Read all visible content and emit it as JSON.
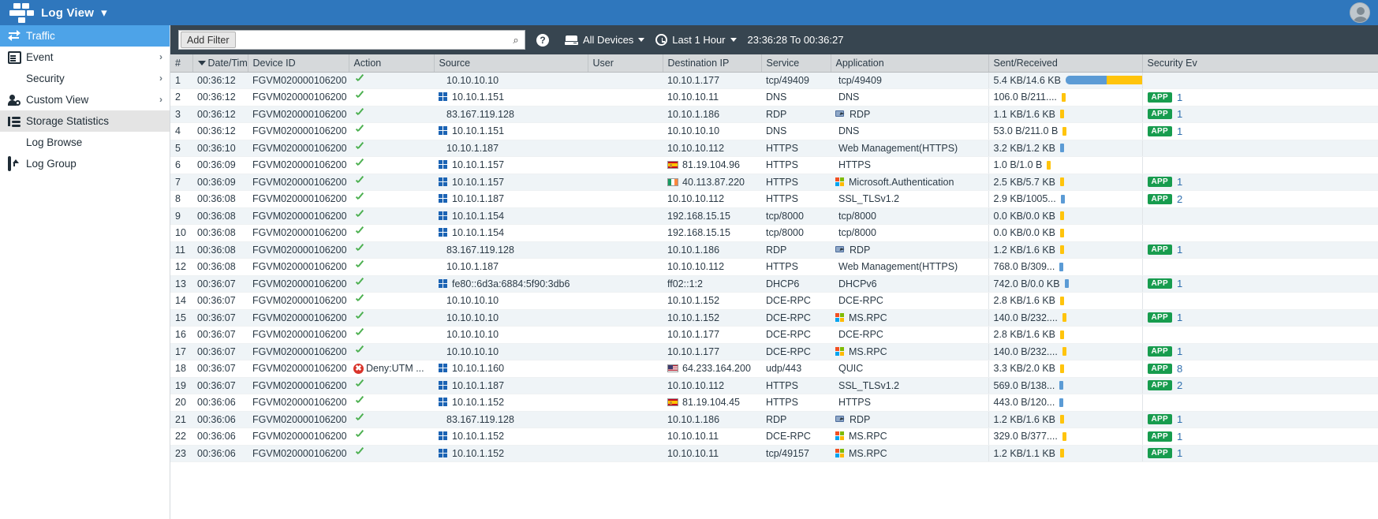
{
  "app": {
    "title": "Log View",
    "logo_icon": "grid-logo-icon",
    "title_chevron_icon": "chevron-down-icon",
    "avatar_icon": "user-avatar-icon",
    "brand_color": "#2f77bd"
  },
  "sidebar": {
    "items": [
      {
        "label": "Traffic",
        "icon": "traffic-icon",
        "state": "active",
        "chevron": ""
      },
      {
        "label": "Event",
        "icon": "event-icon",
        "state": "normal",
        "chevron": "›"
      },
      {
        "label": "Security",
        "icon": "shield-icon",
        "state": "normal",
        "chevron": "›"
      },
      {
        "label": "Custom View",
        "icon": "custom-view-icon",
        "state": "normal",
        "chevron": "›"
      },
      {
        "label": "Storage Statistics",
        "icon": "storage-icon",
        "state": "hover",
        "chevron": ""
      },
      {
        "label": "Log Browse",
        "icon": "log-browse-icon",
        "state": "normal",
        "chevron": ""
      },
      {
        "label": "Log Group",
        "icon": "log-group-icon",
        "state": "normal",
        "chevron": ""
      }
    ]
  },
  "toolbar": {
    "add_filter_label": "Add Filter",
    "filter_value": "",
    "filter_placeholder": "",
    "search_icon": "search-icon",
    "help_icon": "help-icon",
    "help_label": "?",
    "devices_icon": "device-icon",
    "devices_label": "All Devices",
    "time_icon": "clock-icon",
    "time_label": "Last 1 Hour",
    "time_range": "23:36:28 To 00:36:27"
  },
  "table": {
    "columns": [
      "#",
      "Date/Time",
      "Device ID",
      "Action",
      "Source",
      "User",
      "Destination IP",
      "Service",
      "Application",
      "Sent/Received",
      "Security Ev"
    ],
    "sorted_column": "Date/Time",
    "sort_direction": "desc",
    "rows": [
      {
        "num": "1",
        "time": "00:36:12",
        "device": "FGVM020000106200",
        "action": "allow",
        "action_text": "",
        "src_icon": "",
        "src": "10.10.10.10",
        "user": "",
        "dst_icon": "",
        "dst": "10.10.1.177",
        "service": "tcp/49409",
        "app_icon": "",
        "app": "tcp/49409",
        "sent": "5.4 KB/14.6 KB",
        "bar": "dual-wide",
        "sec_badge": "",
        "sec_count": ""
      },
      {
        "num": "2",
        "time": "00:36:12",
        "device": "FGVM020000106200",
        "action": "allow",
        "action_text": "",
        "src_icon": "windows",
        "src": "10.10.1.151",
        "user": "",
        "dst_icon": "",
        "dst": "10.10.10.11",
        "service": "DNS",
        "app_icon": "",
        "app": "DNS",
        "sent": "106.0 B/211....",
        "bar": "yellow",
        "sec_badge": "APP",
        "sec_count": "1"
      },
      {
        "num": "3",
        "time": "00:36:12",
        "device": "FGVM020000106200",
        "action": "allow",
        "action_text": "",
        "src_icon": "",
        "src": "83.167.119.128",
        "user": "",
        "dst_icon": "",
        "dst": "10.10.1.186",
        "service": "RDP",
        "app_icon": "rdp",
        "app": "RDP",
        "sent": "1.1 KB/1.6 KB",
        "bar": "yellow",
        "sec_badge": "APP",
        "sec_count": "1"
      },
      {
        "num": "4",
        "time": "00:36:12",
        "device": "FGVM020000106200",
        "action": "allow",
        "action_text": "",
        "src_icon": "windows",
        "src": "10.10.1.151",
        "user": "",
        "dst_icon": "",
        "dst": "10.10.10.10",
        "service": "DNS",
        "app_icon": "",
        "app": "DNS",
        "sent": "53.0 B/211.0 B",
        "bar": "yellow",
        "sec_badge": "APP",
        "sec_count": "1"
      },
      {
        "num": "5",
        "time": "00:36:10",
        "device": "FGVM020000106200",
        "action": "allow",
        "action_text": "",
        "src_icon": "",
        "src": "10.10.1.187",
        "user": "",
        "dst_icon": "",
        "dst": "10.10.10.112",
        "service": "HTTPS",
        "app_icon": "",
        "app": "Web Management(HTTPS)",
        "sent": "3.2 KB/1.2 KB",
        "bar": "blue",
        "sec_badge": "",
        "sec_count": ""
      },
      {
        "num": "6",
        "time": "00:36:09",
        "device": "FGVM020000106200",
        "action": "allow",
        "action_text": "",
        "src_icon": "windows",
        "src": "10.10.1.157",
        "user": "",
        "dst_icon": "flag-es",
        "dst": "81.19.104.96",
        "service": "HTTPS",
        "app_icon": "",
        "app": "HTTPS",
        "sent": "1.0 B/1.0 B",
        "bar": "yellow",
        "sec_badge": "",
        "sec_count": ""
      },
      {
        "num": "7",
        "time": "00:36:09",
        "device": "FGVM020000106200",
        "action": "allow",
        "action_text": "",
        "src_icon": "windows",
        "src": "10.10.1.157",
        "user": "",
        "dst_icon": "flag-ie",
        "dst": "40.113.87.220",
        "service": "HTTPS",
        "app_icon": "microsoft",
        "app": "Microsoft.Authentication",
        "sent": "2.5 KB/5.7 KB",
        "bar": "yellow",
        "sec_badge": "APP",
        "sec_count": "1"
      },
      {
        "num": "8",
        "time": "00:36:08",
        "device": "FGVM020000106200",
        "action": "allow",
        "action_text": "",
        "src_icon": "windows",
        "src": "10.10.1.187",
        "user": "",
        "dst_icon": "",
        "dst": "10.10.10.112",
        "service": "HTTPS",
        "app_icon": "",
        "app": "SSL_TLSv1.2",
        "sent": "2.9 KB/1005...",
        "bar": "blue",
        "sec_badge": "APP",
        "sec_count": "2"
      },
      {
        "num": "9",
        "time": "00:36:08",
        "device": "FGVM020000106200",
        "action": "allow",
        "action_text": "",
        "src_icon": "windows",
        "src": "10.10.1.154",
        "user": "",
        "dst_icon": "",
        "dst": "192.168.15.15",
        "service": "tcp/8000",
        "app_icon": "",
        "app": "tcp/8000",
        "sent": "0.0 KB/0.0 KB",
        "bar": "yellow",
        "sec_badge": "",
        "sec_count": ""
      },
      {
        "num": "10",
        "time": "00:36:08",
        "device": "FGVM020000106200",
        "action": "allow",
        "action_text": "",
        "src_icon": "windows",
        "src": "10.10.1.154",
        "user": "",
        "dst_icon": "",
        "dst": "192.168.15.15",
        "service": "tcp/8000",
        "app_icon": "",
        "app": "tcp/8000",
        "sent": "0.0 KB/0.0 KB",
        "bar": "yellow",
        "sec_badge": "",
        "sec_count": ""
      },
      {
        "num": "11",
        "time": "00:36:08",
        "device": "FGVM020000106200",
        "action": "allow",
        "action_text": "",
        "src_icon": "",
        "src": "83.167.119.128",
        "user": "",
        "dst_icon": "",
        "dst": "10.10.1.186",
        "service": "RDP",
        "app_icon": "rdp",
        "app": "RDP",
        "sent": "1.2 KB/1.6 KB",
        "bar": "yellow",
        "sec_badge": "APP",
        "sec_count": "1"
      },
      {
        "num": "12",
        "time": "00:36:08",
        "device": "FGVM020000106200",
        "action": "allow",
        "action_text": "",
        "src_icon": "",
        "src": "10.10.1.187",
        "user": "",
        "dst_icon": "",
        "dst": "10.10.10.112",
        "service": "HTTPS",
        "app_icon": "",
        "app": "Web Management(HTTPS)",
        "sent": "768.0 B/309...",
        "bar": "blue",
        "sec_badge": "",
        "sec_count": ""
      },
      {
        "num": "13",
        "time": "00:36:07",
        "device": "FGVM020000106200",
        "action": "allow",
        "action_text": "",
        "src_icon": "windows",
        "src": "fe80::6d3a:6884:5f90:3db6",
        "user": "",
        "dst_icon": "",
        "dst": "ff02::1:2",
        "service": "DHCP6",
        "app_icon": "",
        "app": "DHCPv6",
        "sent": "742.0 B/0.0 KB",
        "bar": "blue",
        "sec_badge": "APP",
        "sec_count": "1"
      },
      {
        "num": "14",
        "time": "00:36:07",
        "device": "FGVM020000106200",
        "action": "allow",
        "action_text": "",
        "src_icon": "",
        "src": "10.10.10.10",
        "user": "",
        "dst_icon": "",
        "dst": "10.10.1.152",
        "service": "DCE-RPC",
        "app_icon": "",
        "app": "DCE-RPC",
        "sent": "2.8 KB/1.6 KB",
        "bar": "yellow",
        "sec_badge": "",
        "sec_count": ""
      },
      {
        "num": "15",
        "time": "00:36:07",
        "device": "FGVM020000106200",
        "action": "allow",
        "action_text": "",
        "src_icon": "",
        "src": "10.10.10.10",
        "user": "",
        "dst_icon": "",
        "dst": "10.10.1.152",
        "service": "DCE-RPC",
        "app_icon": "microsoft",
        "app": "MS.RPC",
        "sent": "140.0 B/232....",
        "bar": "yellow",
        "sec_badge": "APP",
        "sec_count": "1"
      },
      {
        "num": "16",
        "time": "00:36:07",
        "device": "FGVM020000106200",
        "action": "allow",
        "action_text": "",
        "src_icon": "",
        "src": "10.10.10.10",
        "user": "",
        "dst_icon": "",
        "dst": "10.10.1.177",
        "service": "DCE-RPC",
        "app_icon": "",
        "app": "DCE-RPC",
        "sent": "2.8 KB/1.6 KB",
        "bar": "yellow",
        "sec_badge": "",
        "sec_count": ""
      },
      {
        "num": "17",
        "time": "00:36:07",
        "device": "FGVM020000106200",
        "action": "allow",
        "action_text": "",
        "src_icon": "",
        "src": "10.10.10.10",
        "user": "",
        "dst_icon": "",
        "dst": "10.10.1.177",
        "service": "DCE-RPC",
        "app_icon": "microsoft",
        "app": "MS.RPC",
        "sent": "140.0 B/232....",
        "bar": "yellow",
        "sec_badge": "APP",
        "sec_count": "1"
      },
      {
        "num": "18",
        "time": "00:36:07",
        "device": "FGVM020000106200",
        "action": "deny",
        "action_text": "Deny:UTM ...",
        "src_icon": "windows",
        "src": "10.10.1.160",
        "user": "",
        "dst_icon": "flag-us",
        "dst": "64.233.164.200",
        "service": "udp/443",
        "app_icon": "",
        "app": "QUIC",
        "sent": "3.3 KB/2.0 KB",
        "bar": "yellow",
        "sec_badge": "APP",
        "sec_count": "8"
      },
      {
        "num": "19",
        "time": "00:36:07",
        "device": "FGVM020000106200",
        "action": "allow",
        "action_text": "",
        "src_icon": "windows",
        "src": "10.10.1.187",
        "user": "",
        "dst_icon": "",
        "dst": "10.10.10.112",
        "service": "HTTPS",
        "app_icon": "",
        "app": "SSL_TLSv1.2",
        "sent": "569.0 B/138...",
        "bar": "blue",
        "sec_badge": "APP",
        "sec_count": "2"
      },
      {
        "num": "20",
        "time": "00:36:06",
        "device": "FGVM020000106200",
        "action": "allow",
        "action_text": "",
        "src_icon": "windows",
        "src": "10.10.1.152",
        "user": "",
        "dst_icon": "flag-es",
        "dst": "81.19.104.45",
        "service": "HTTPS",
        "app_icon": "",
        "app": "HTTPS",
        "sent": "443.0 B/120...",
        "bar": "blue",
        "sec_badge": "",
        "sec_count": ""
      },
      {
        "num": "21",
        "time": "00:36:06",
        "device": "FGVM020000106200",
        "action": "allow",
        "action_text": "",
        "src_icon": "",
        "src": "83.167.119.128",
        "user": "",
        "dst_icon": "",
        "dst": "10.10.1.186",
        "service": "RDP",
        "app_icon": "rdp",
        "app": "RDP",
        "sent": "1.2 KB/1.6 KB",
        "bar": "yellow",
        "sec_badge": "APP",
        "sec_count": "1"
      },
      {
        "num": "22",
        "time": "00:36:06",
        "device": "FGVM020000106200",
        "action": "allow",
        "action_text": "",
        "src_icon": "windows",
        "src": "10.10.1.152",
        "user": "",
        "dst_icon": "",
        "dst": "10.10.10.11",
        "service": "DCE-RPC",
        "app_icon": "microsoft",
        "app": "MS.RPC",
        "sent": "329.0 B/377....",
        "bar": "yellow",
        "sec_badge": "APP",
        "sec_count": "1"
      },
      {
        "num": "23",
        "time": "00:36:06",
        "device": "FGVM020000106200",
        "action": "allow",
        "action_text": "",
        "src_icon": "windows",
        "src": "10.10.1.152",
        "user": "",
        "dst_icon": "",
        "dst": "10.10.10.11",
        "service": "tcp/49157",
        "app_icon": "microsoft",
        "app": "MS.RPC",
        "sent": "1.2 KB/1.1 KB",
        "bar": "yellow",
        "sec_badge": "APP",
        "sec_count": "1"
      }
    ]
  }
}
